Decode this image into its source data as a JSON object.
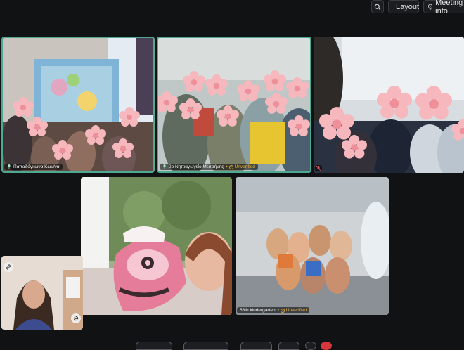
{
  "toolbar": {
    "zoom_icon": "zoom-icon",
    "layout_label": "Layout",
    "layout_icon": "layout-grid-icon",
    "meeting_info_label": "Meeting info",
    "meeting_info_icon": "info-pin-icon"
  },
  "participants": [
    {
      "name": "Παπαδόγκωνα Κων/να",
      "unverified": "",
      "active": true
    },
    {
      "name": "2o Νηπιαγωγείο Μεσσήνης",
      "unverified": "Unverified",
      "active": true
    },
    {
      "name": "",
      "unverified": "",
      "active": false
    },
    {
      "name": "",
      "unverified": "",
      "active": false
    },
    {
      "name": "68th kindergarten",
      "unverified": "Unverified",
      "active": false
    },
    {
      "name": "",
      "unverified": "",
      "active": false
    }
  ],
  "colors": {
    "active_border": "#4fa992",
    "unverified": "#f2b43a",
    "background": "#111214",
    "flower": "#f6b7bd"
  }
}
